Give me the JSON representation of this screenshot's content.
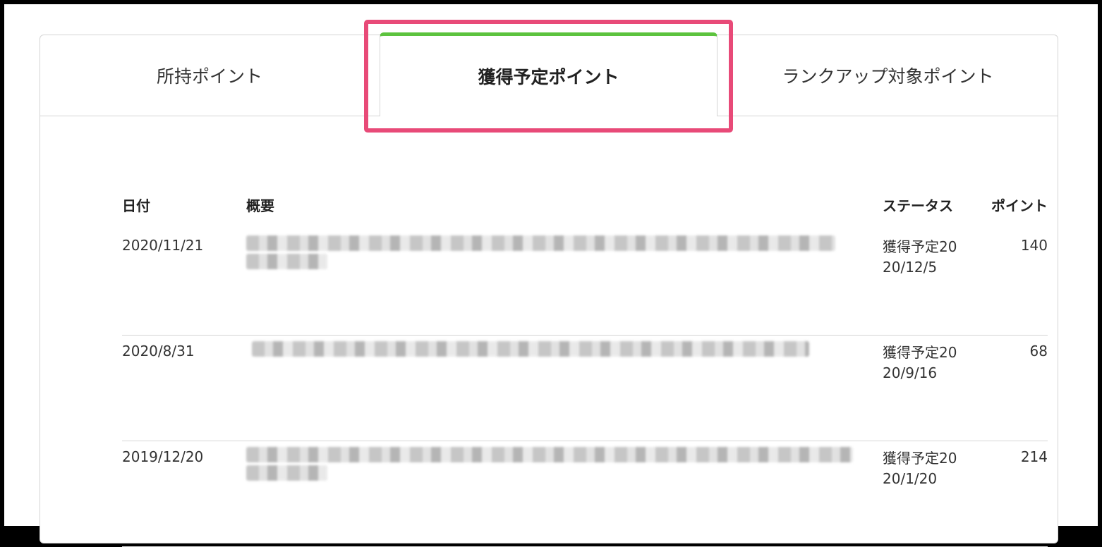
{
  "tabs": {
    "owned": "所持ポイント",
    "scheduled": "獲得予定ポイント",
    "rankup": "ランクアップ対象ポイント"
  },
  "colors": {
    "active_tab_accent": "#5cc33e",
    "highlight_border": "#e84a78"
  },
  "table": {
    "headers": {
      "date": "日付",
      "summary": "概要",
      "status": "ステータス",
      "points": "ポイント"
    },
    "rows": [
      {
        "date": "2020/11/21",
        "summary": "",
        "status": "獲得予定2020/12/5",
        "points": "140"
      },
      {
        "date": "2020/8/31",
        "summary": "",
        "status": "獲得予定2020/9/16",
        "points": "68"
      },
      {
        "date": "2019/12/20",
        "summary": "",
        "status": "獲得予定2020/1/20",
        "points": "214"
      }
    ]
  }
}
